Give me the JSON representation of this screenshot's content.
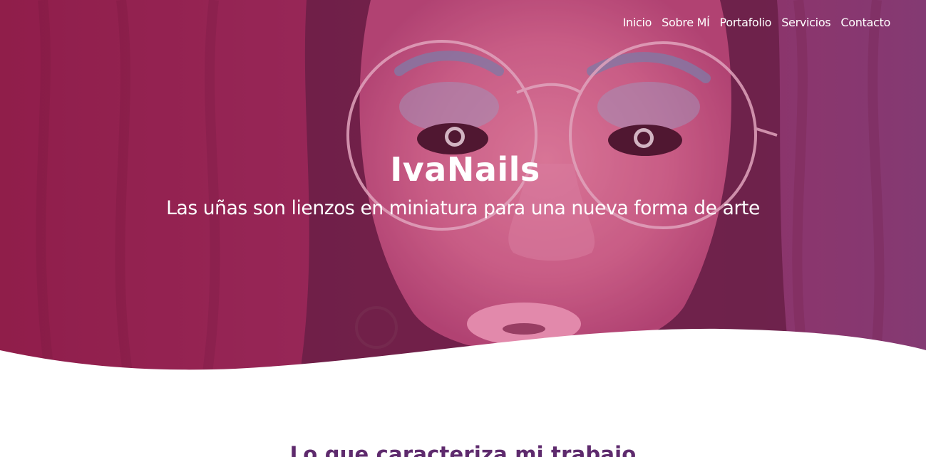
{
  "nav": {
    "items": [
      {
        "label": "Inicio"
      },
      {
        "label": "Sobre MÍ"
      },
      {
        "label": "Portafolio"
      },
      {
        "label": "Servicios"
      },
      {
        "label": "Contacto"
      }
    ]
  },
  "hero": {
    "title": "IvaNails",
    "subtitle": "Las uñas son lienzos en miniatura para una nueva forma de arte",
    "overlay_color_start": "#8e1d47",
    "overlay_color_end": "#7e3e78"
  },
  "section": {
    "title": "Lo que caracteriza mi trabajo",
    "title_color": "#5e2a6d"
  }
}
